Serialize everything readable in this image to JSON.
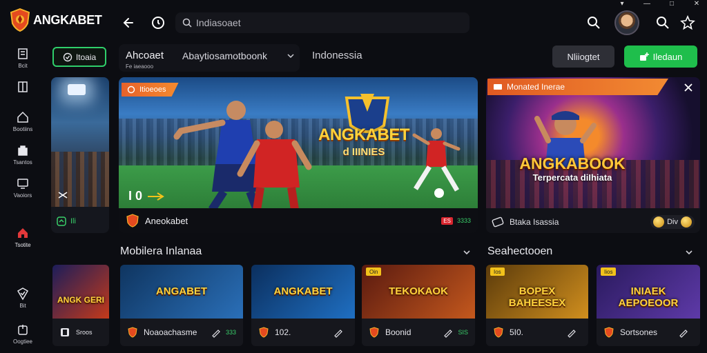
{
  "brand": {
    "name": "ANGKABET"
  },
  "topbar": {
    "search_placeholder": "Indiasoaet"
  },
  "sidebar": {
    "items": [
      {
        "label": "Bcit",
        "icon": "shield-icon"
      },
      {
        "label": "",
        "icon": "book-icon"
      },
      {
        "label": "Bootiins",
        "icon": "home-icon"
      },
      {
        "label": "Tsantos",
        "icon": "bag-icon"
      },
      {
        "label": "Vaoiors",
        "icon": "monitor-icon"
      },
      {
        "label": "Tsotite",
        "icon": "home-active-icon"
      },
      {
        "label": "Bit",
        "icon": "check-shield-icon"
      },
      {
        "label": "Oogtiee",
        "icon": "power-icon"
      }
    ]
  },
  "filters": {
    "pill_label": "Itoaia",
    "lang_title": "Ahcoaet",
    "lang_select": "Abaytiosamotboonk",
    "lang_sub": "Fe iaeaooo",
    "region": "Indonessia",
    "btn_dark": "Nliiogtet",
    "btn_green": "Iledaun"
  },
  "side_card": {
    "footer": "Ili"
  },
  "hero": {
    "badge": "Itioeoes",
    "logo_title": "ANGKABET",
    "logo_sub": "d IIINIES",
    "score": "I 0",
    "footer_title": "Aneokabet",
    "live_tag": "ES",
    "footer_stat": "3333"
  },
  "promo": {
    "bar_title": "Monated Inerae",
    "title": "ANGKABOOK",
    "subtitle": "Terpercata diIhiata",
    "footer_left": "Btaka Isassia",
    "footer_right": "Div"
  },
  "sections": {
    "left_title": "Mobilera Inlanaa",
    "right_title": "Seahectooen"
  },
  "partial_tile": {
    "name": "ANGK GERI",
    "footer": "Sroos"
  },
  "tiles": [
    {
      "tag": "",
      "name": "ANGABET",
      "footer": "Noaoachasme",
      "stat": "333",
      "colors": [
        "#0f3560",
        "#2a6fb8"
      ]
    },
    {
      "tag": "",
      "name": "ANGKABET",
      "footer": "102.",
      "stat": "",
      "colors": [
        "#0b2f5e",
        "#1f6fc2"
      ]
    },
    {
      "tag": "Oin",
      "name": "TEKOKAOK",
      "footer": "Boonid",
      "stat": "SIS",
      "colors": [
        "#5a1a10",
        "#c4581d"
      ]
    },
    {
      "tag": "Ios",
      "name": "BOPEX BAHEESEX",
      "footer": "5I0.",
      "stat": "",
      "colors": [
        "#5b3b0b",
        "#d18f1e"
      ]
    },
    {
      "tag": "Iios",
      "name": "INIAEK AEPOEOOR",
      "footer": "Sortsones",
      "stat": "",
      "colors": [
        "#2a1a5e",
        "#5e3aa8"
      ]
    }
  ],
  "accent": {
    "green": "#1fbe4c",
    "orange": "#f08a2f"
  }
}
